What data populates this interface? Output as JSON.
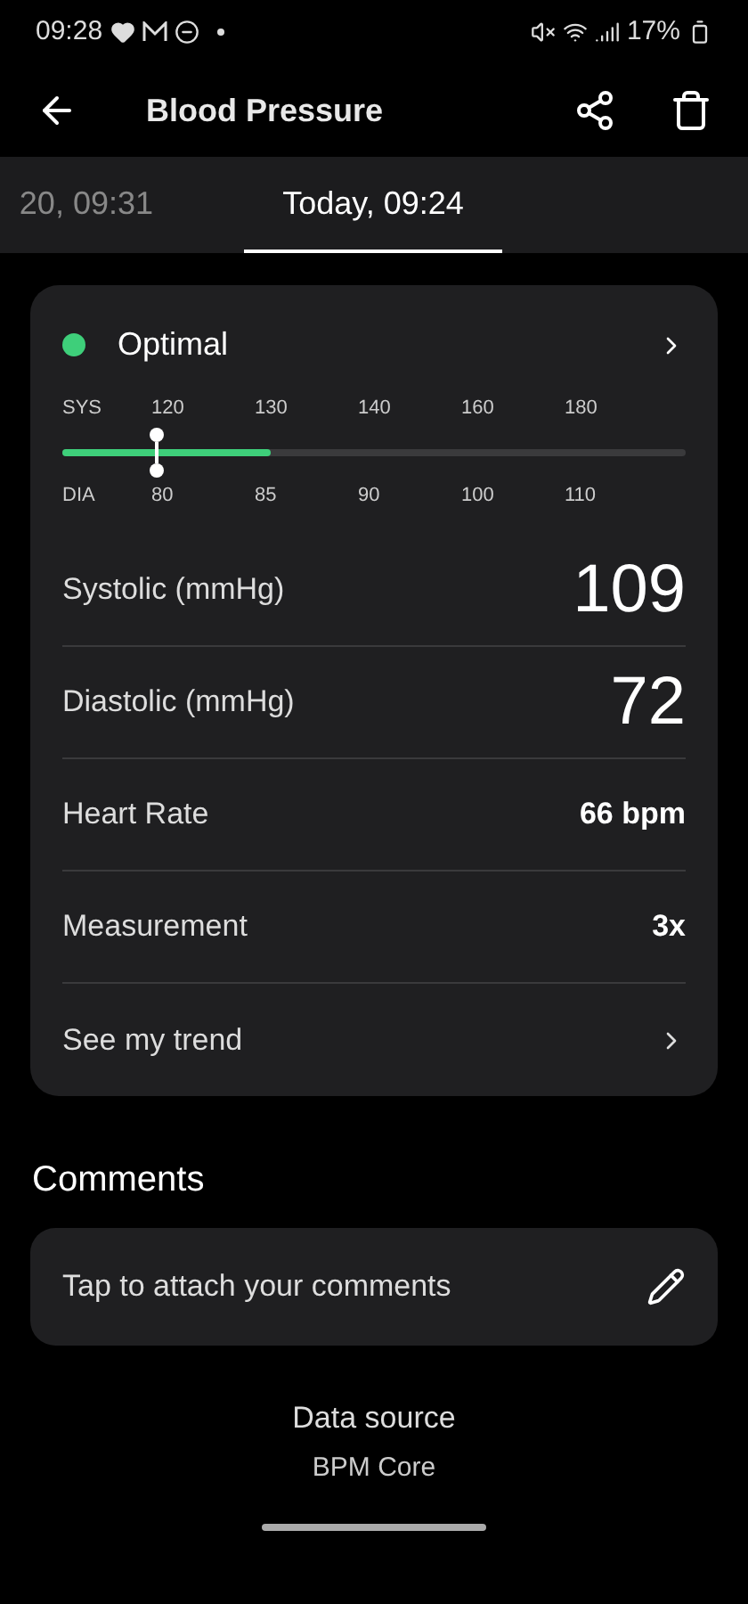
{
  "status_bar": {
    "time": "09:28",
    "battery": "17%"
  },
  "header": {
    "title": "Blood Pressure"
  },
  "tabs": [
    {
      "label": "20, 09:31",
      "selected": false
    },
    {
      "label": "Today, 09:24",
      "selected": true
    }
  ],
  "card": {
    "status": {
      "label": "Optimal",
      "color": "#3ecf7a"
    },
    "scale": {
      "sys_label": "SYS",
      "dia_label": "DIA",
      "sys_ticks": [
        "120",
        "130",
        "140",
        "160",
        "180"
      ],
      "dia_ticks": [
        "80",
        "85",
        "90",
        "100",
        "110"
      ],
      "fill": {
        "level": 0.333
      }
    },
    "rows": [
      {
        "kind": "big",
        "label": "Systolic (mmHg)",
        "value": "109"
      },
      {
        "kind": "big",
        "label": "Diastolic (mmHg)",
        "value": "72"
      },
      {
        "kind": "value",
        "label": "Heart Rate",
        "value": "66 bpm"
      },
      {
        "kind": "value",
        "label": "Measurement",
        "value": "3x"
      },
      {
        "kind": "link",
        "label": "See my trend"
      }
    ]
  },
  "comments": {
    "title": "Comments",
    "placeholder": "Tap to attach your comments"
  },
  "data_source": {
    "label": "Data source",
    "value": "BPM Core"
  }
}
